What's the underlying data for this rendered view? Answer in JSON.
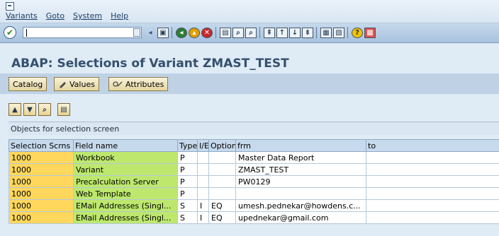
{
  "menu": {
    "items": [
      "Variants",
      "Goto",
      "System",
      "Help"
    ]
  },
  "toolbar": {
    "command_value": ""
  },
  "page": {
    "title": "ABAP: Selections of Variant ZMAST_TEST"
  },
  "app_toolbar": {
    "catalog_label": "Catalog",
    "values_label": "Values",
    "attributes_label": "Attributes"
  },
  "grid": {
    "title": "Objects for selection screen",
    "columns": [
      "Selection Scrns",
      "Field name",
      "Type",
      "I/E",
      "Option",
      "frm",
      "to"
    ],
    "rows": [
      [
        "1000",
        "Workbook",
        "P",
        "",
        "",
        "Master Data Report",
        ""
      ],
      [
        "1000",
        "Variant",
        "P",
        "",
        "",
        "ZMAST_TEST",
        ""
      ],
      [
        "1000",
        "Precalculation Server",
        "P",
        "",
        "",
        "PW0129",
        ""
      ],
      [
        "1000",
        "Web Template",
        "P",
        "",
        "",
        "",
        ""
      ],
      [
        "1000",
        "EMail Addresses (Singl...",
        "S",
        "I",
        "EQ",
        "umesh.pednekar@howdens.c...",
        ""
      ],
      [
        "1000",
        "EMail Addresses (Singl...",
        "S",
        "I",
        "EQ",
        "upednekar@gmail.com",
        ""
      ]
    ]
  },
  "colors": {
    "key_cell": "#ffd75c",
    "field_cell": "#bde86d",
    "title_text": "#35506e"
  },
  "icons": [
    "system-menu-icon",
    "enter-check-icon",
    "save-icon",
    "back-icon",
    "exit-icon",
    "cancel-icon",
    "print-icon",
    "find-icon",
    "find-next-icon",
    "first-page-icon",
    "previous-page-icon",
    "next-page-icon",
    "last-page-icon",
    "create-session-icon",
    "shortcut-icon",
    "help-icon",
    "layout-icon"
  ]
}
